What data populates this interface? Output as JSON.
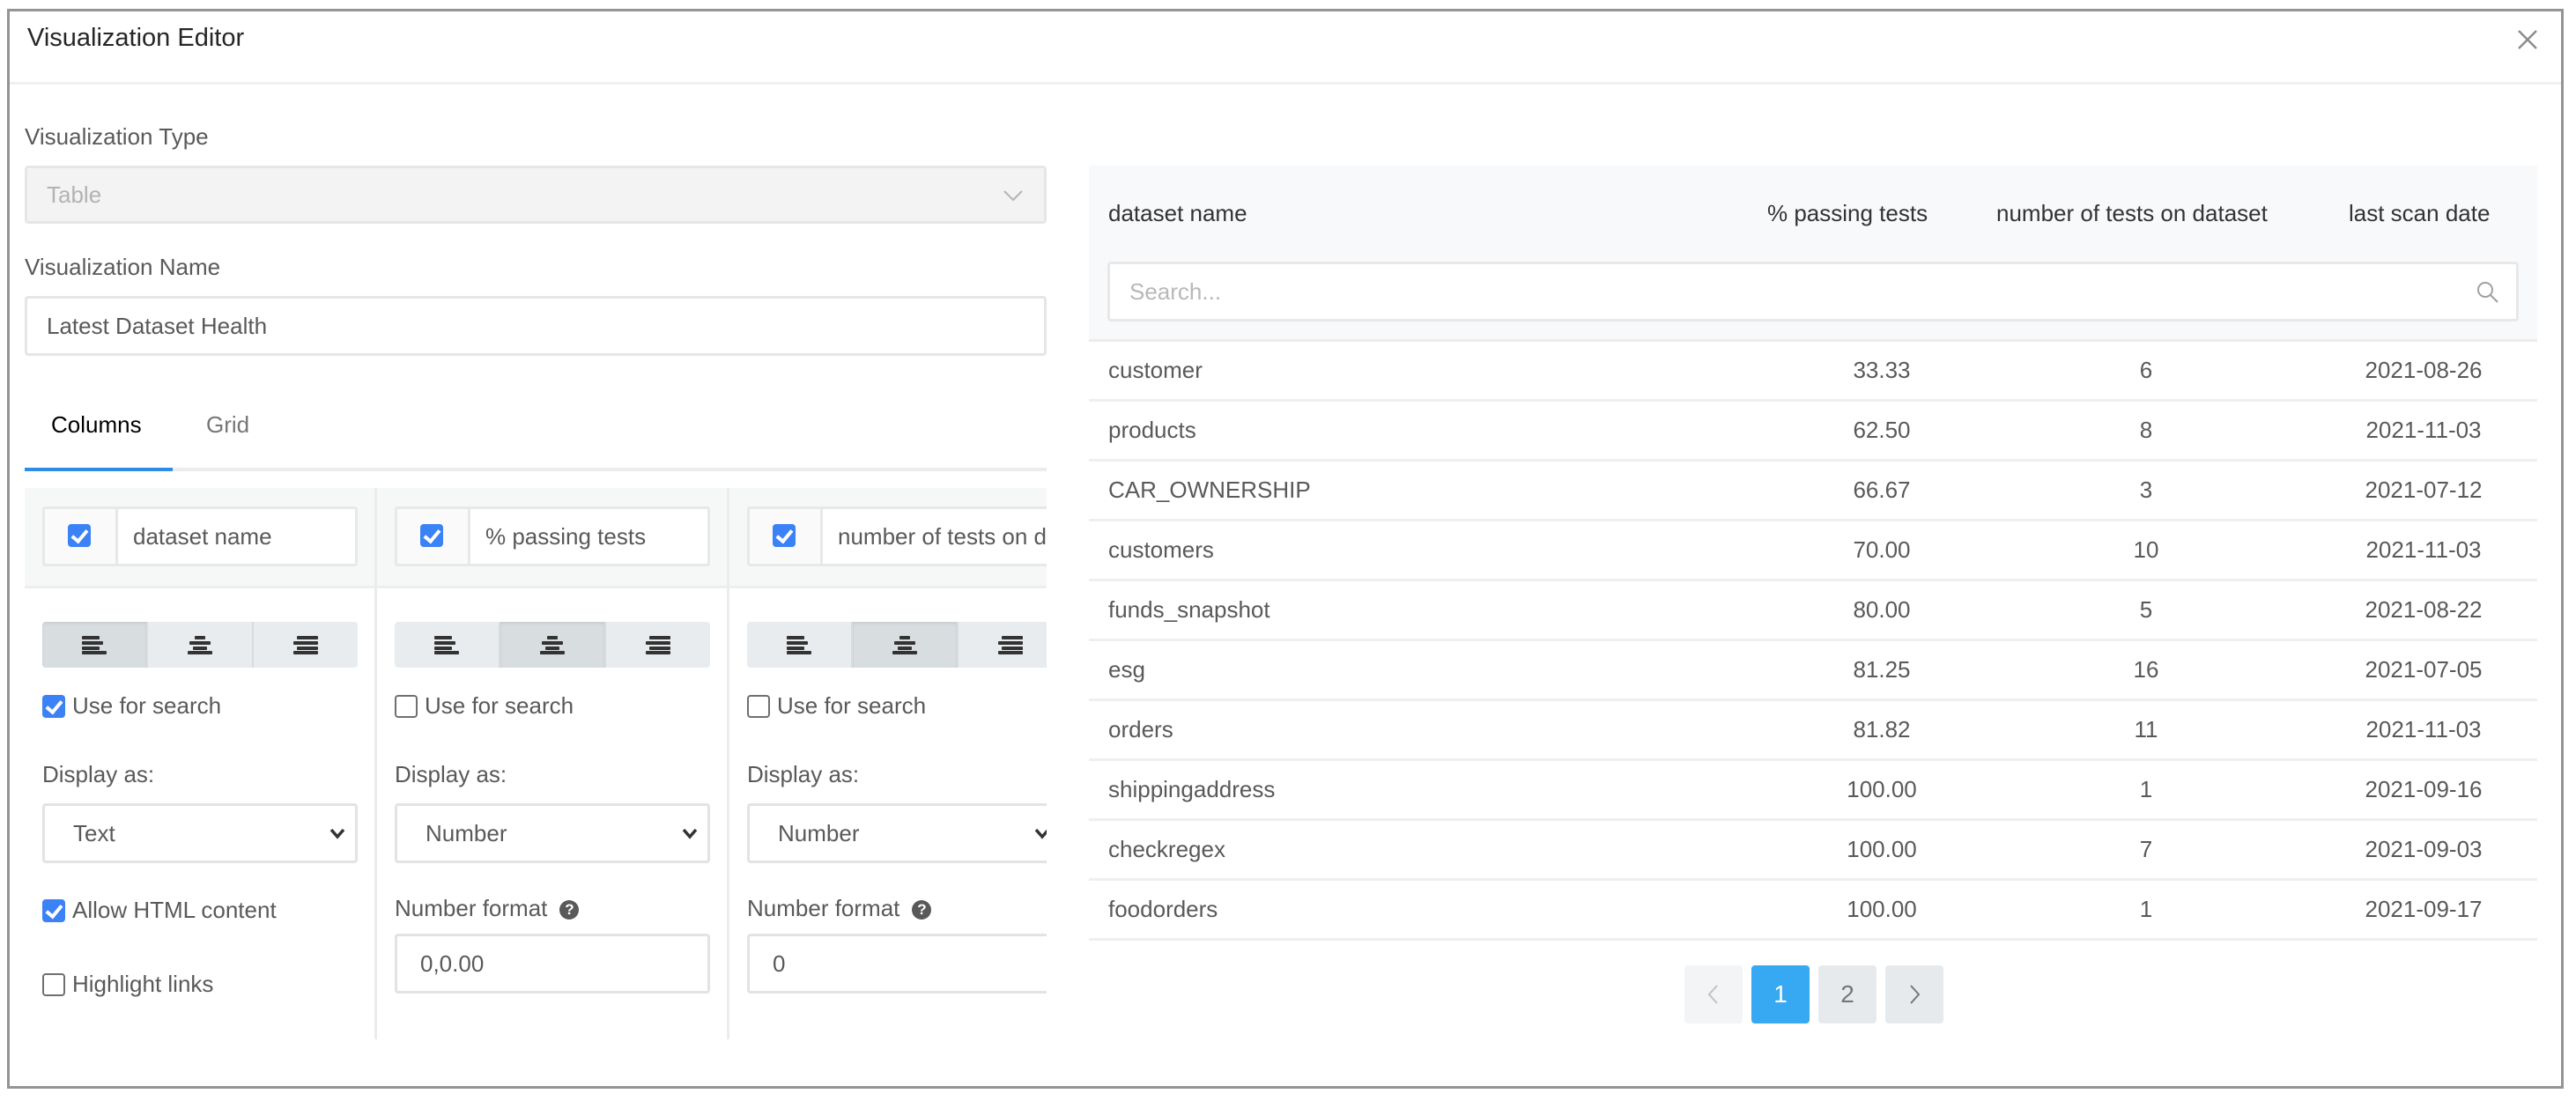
{
  "modal": {
    "title": "Visualization Editor",
    "close_icon": "close-icon"
  },
  "form": {
    "type_label": "Visualization Type",
    "type_value": "Table",
    "name_label": "Visualization Name",
    "name_value": "Latest Dataset Health"
  },
  "tabs": [
    {
      "label": "Columns",
      "active": true
    },
    {
      "label": "Grid",
      "active": false
    }
  ],
  "columns": [
    {
      "visible": true,
      "name": "dataset name",
      "alignment": "left",
      "use_for_search": true,
      "use_for_search_label": "Use for search",
      "display_as_label": "Display as:",
      "display_as": "Text",
      "allow_html": true,
      "allow_html_label": "Allow HTML content",
      "highlight_links": false,
      "highlight_links_label": "Highlight links"
    },
    {
      "visible": true,
      "name": "% passing tests",
      "alignment": "center",
      "use_for_search": false,
      "use_for_search_label": "Use for search",
      "display_as_label": "Display as:",
      "display_as": "Number",
      "number_format_label": "Number format",
      "number_format": "0,0.00"
    },
    {
      "visible": true,
      "name": "number of tests on dataset",
      "alignment": "center",
      "use_for_search": false,
      "use_for_search_label": "Use for search",
      "display_as_label": "Display as:",
      "display_as": "Number",
      "number_format_label": "Number format",
      "number_format": "0"
    }
  ],
  "preview": {
    "headers": [
      "dataset name",
      "% passing tests",
      "number of tests on dataset",
      "last scan date"
    ],
    "search_placeholder": "Search...",
    "rows": [
      [
        "customer",
        "33.33",
        "6",
        "2021-08-26"
      ],
      [
        "products",
        "62.50",
        "8",
        "2021-11-03"
      ],
      [
        "CAR_OWNERSHIP",
        "66.67",
        "3",
        "2021-07-12"
      ],
      [
        "customers",
        "70.00",
        "10",
        "2021-11-03"
      ],
      [
        "funds_snapshot",
        "80.00",
        "5",
        "2021-08-22"
      ],
      [
        "esg",
        "81.25",
        "16",
        "2021-07-05"
      ],
      [
        "orders",
        "81.82",
        "11",
        "2021-11-03"
      ],
      [
        "shippingaddress",
        "100.00",
        "1",
        "2021-09-16"
      ],
      [
        "checkregex",
        "100.00",
        "7",
        "2021-09-03"
      ],
      [
        "foodorders",
        "100.00",
        "1",
        "2021-09-17"
      ]
    ],
    "pagination": {
      "pages": [
        "1",
        "2"
      ],
      "current": "1",
      "prev_disabled": true
    }
  },
  "colors": {
    "accent": "#2d8ce6",
    "checkbox": "#3b82f6",
    "page_active": "#36a9f2"
  }
}
